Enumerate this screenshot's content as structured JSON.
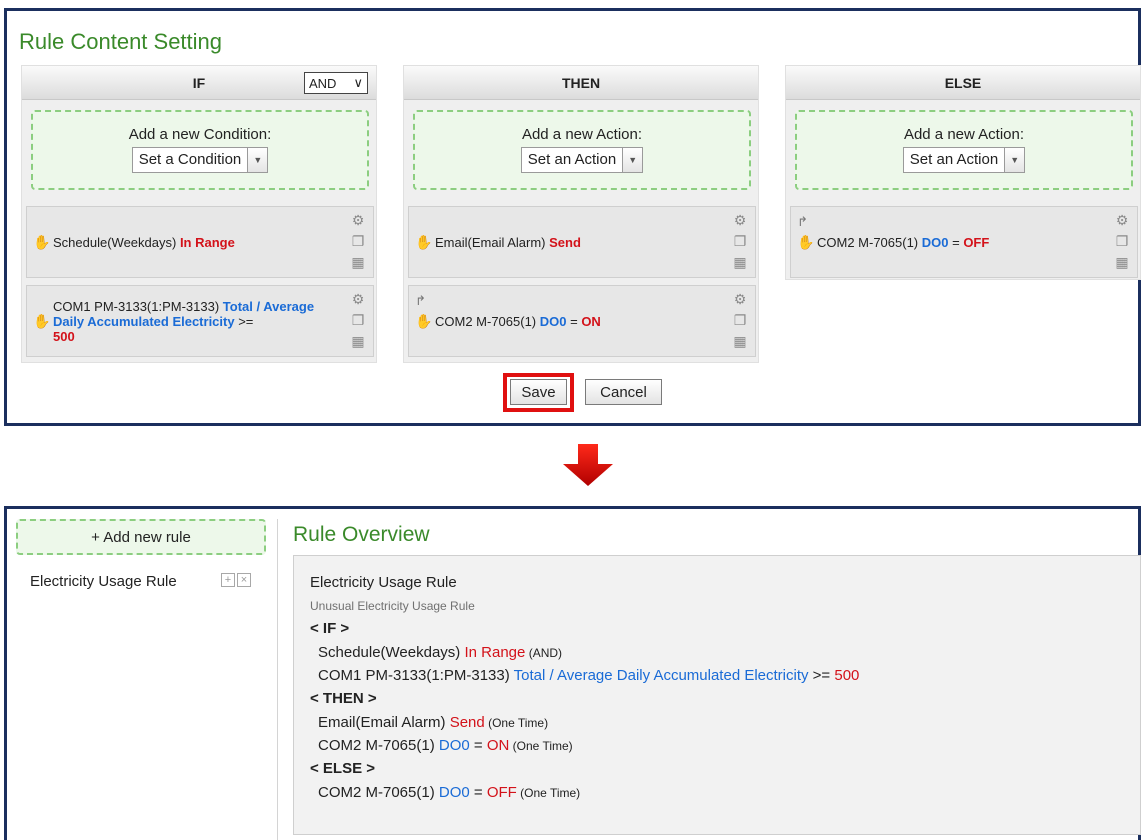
{
  "top": {
    "title": "Rule Content Setting",
    "if": {
      "header": "IF",
      "logic_value": "AND",
      "add_label": "Add a new Condition:",
      "add_select": "Set a Condition",
      "items": [
        {
          "pre": "Schedule(Weekdays) ",
          "red": "In Range"
        },
        {
          "pre": "COM1 PM-3133(1:PM-3133) ",
          "blue": "Total / Average Daily Accumulated Electricity",
          "mid": " >=",
          "red": "500"
        }
      ]
    },
    "then": {
      "header": "THEN",
      "add_label": "Add a new Action:",
      "add_select": "Set an Action",
      "items": [
        {
          "pre": "Email(Email Alarm) ",
          "red": "Send"
        },
        {
          "pre": "COM2 M-7065(1) ",
          "blue": "DO0",
          "mid": " = ",
          "red": "ON"
        }
      ]
    },
    "else": {
      "header": "ELSE",
      "add_label": "Add a new Action:",
      "add_select": "Set an Action",
      "items": [
        {
          "pre": "COM2 M-7065(1) ",
          "blue": "DO0",
          "mid": " = ",
          "red": "OFF"
        }
      ]
    },
    "save_label": "Save",
    "cancel_label": "Cancel"
  },
  "bottom": {
    "add_rule_label": "+ Add new rule",
    "rule_name": "Electricity Usage Rule",
    "overview_title": "Rule Overview",
    "overview": {
      "name": "Electricity Usage Rule",
      "description": "Unusual Electricity Usage Rule",
      "if_head": "< IF >",
      "then_head": "< THEN >",
      "else_head": "< ELSE >",
      "if1": {
        "pre": "Schedule(Weekdays) ",
        "red": "In Range",
        "tail": " (AND)"
      },
      "if2": {
        "pre": "COM1 PM-3133(1:PM-3133) ",
        "blue": "Total / Average Daily Accumulated Electricity",
        "mid": " >= ",
        "red": "500"
      },
      "then1": {
        "pre": "Email(Email Alarm) ",
        "red": "Send",
        "tail": " (One Time)"
      },
      "then2": {
        "pre": "COM2 M-7065(1) ",
        "blue": "DO0",
        "mid": " = ",
        "red": "ON",
        "tail": " (One Time)"
      },
      "else1": {
        "pre": "COM2 M-7065(1) ",
        "blue": "DO0",
        "mid": " = ",
        "red": "OFF",
        "tail": " (One Time)"
      }
    }
  },
  "colors": {
    "accent_green": "#3a8a2a",
    "value_red": "#d3121a",
    "field_blue": "#1a6bd6",
    "frame_navy": "#1b2f5e"
  }
}
